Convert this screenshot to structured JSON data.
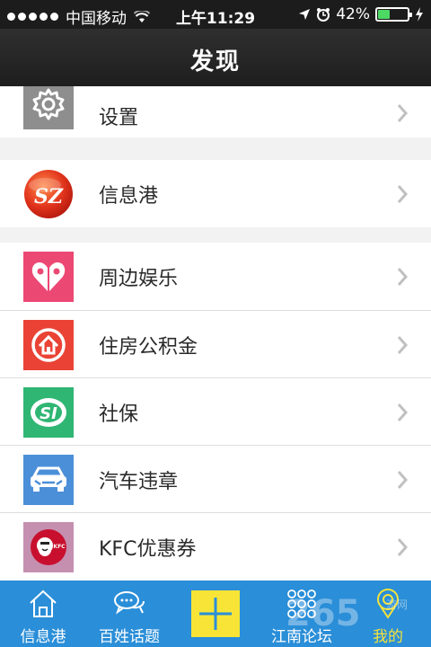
{
  "status_bar": {
    "carrier": "中国移动",
    "time": "上午11:29",
    "battery": "42%",
    "battery_level": 0.42
  },
  "header": {
    "title": "发现"
  },
  "menu": {
    "settings": {
      "label": "设置",
      "icon": "gear-icon"
    },
    "info_port": {
      "label": "信息港",
      "icon": "sz-logo-icon",
      "logo_text": "SZ"
    },
    "entertainment": {
      "label": "周边娱乐",
      "icon": "heart-icon"
    },
    "housing_fund": {
      "label": "住房公积金",
      "icon": "house-icon"
    },
    "social_security": {
      "label": "社保",
      "icon": "si-icon",
      "logo_text": "SI"
    },
    "traffic_violation": {
      "label": "汽车违章",
      "icon": "car-icon"
    },
    "kfc": {
      "label": "KFC优惠券",
      "icon": "kfc-icon",
      "logo_text": "KFC"
    }
  },
  "tab_bar": {
    "tabs": [
      {
        "label": "信息港",
        "icon": "home-icon"
      },
      {
        "label": "百姓话题",
        "icon": "chat-bubbles-icon"
      },
      {
        "label": "",
        "icon": "plus-icon"
      },
      {
        "label": "江南论坛",
        "icon": "grid-dots-icon"
      },
      {
        "label": "我的",
        "icon": "location-pin-icon",
        "active": true
      }
    ]
  },
  "colors": {
    "tab_bar": "#2a8ed8",
    "active_tab": "#f5e33b",
    "plus_button": "#f7e436",
    "battery": "#4cd964"
  },
  "watermark": {
    "text": "265",
    "sub": "游网"
  }
}
